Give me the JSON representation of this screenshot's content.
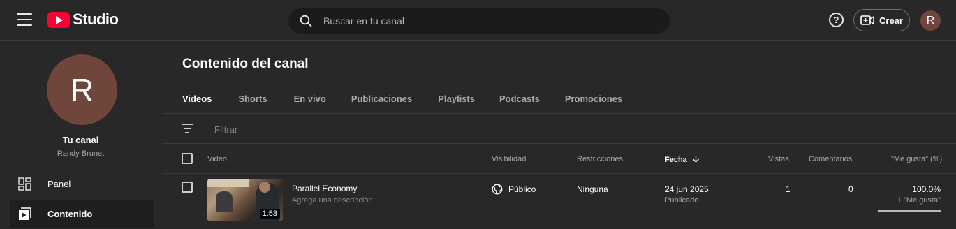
{
  "header": {
    "logo_text": "Studio",
    "search_placeholder": "Buscar en tu canal",
    "help_icon": "?",
    "create_label": "Crear",
    "avatar_letter": "R"
  },
  "sidebar": {
    "avatar_letter": "R",
    "channel_title": "Tu canal",
    "channel_name": "Randy Brunet",
    "items": [
      {
        "label": "Panel",
        "icon": "dashboard-icon",
        "active": false
      },
      {
        "label": "Contenido",
        "icon": "content-icon",
        "active": true
      }
    ]
  },
  "main": {
    "title": "Contenido del canal",
    "tabs": [
      {
        "label": "Videos",
        "active": true
      },
      {
        "label": "Shorts",
        "active": false
      },
      {
        "label": "En vivo",
        "active": false
      },
      {
        "label": "Publicaciones",
        "active": false
      },
      {
        "label": "Playlists",
        "active": false
      },
      {
        "label": "Podcasts",
        "active": false
      },
      {
        "label": "Promociones",
        "active": false
      }
    ],
    "filter_placeholder": "Filtrar",
    "columns": {
      "video": "Video",
      "visibility": "Visibilidad",
      "restrictions": "Restricciones",
      "date": "Fecha",
      "views": "Vistas",
      "comments": "Comentarios",
      "likes": "\"Me gusta\" (%)"
    },
    "rows": [
      {
        "title": "Parallel Economy",
        "description": "Agrega una descripción",
        "duration": "1:53",
        "visibility": "Público",
        "restrictions": "Ninguna",
        "date": "24 jun 2025",
        "date_status": "Publicado",
        "views": "1",
        "comments": "0",
        "likes_pct": "100.0%",
        "likes_count": "1 \"Me gusta\"",
        "likes_fraction": 1.0
      }
    ]
  }
}
